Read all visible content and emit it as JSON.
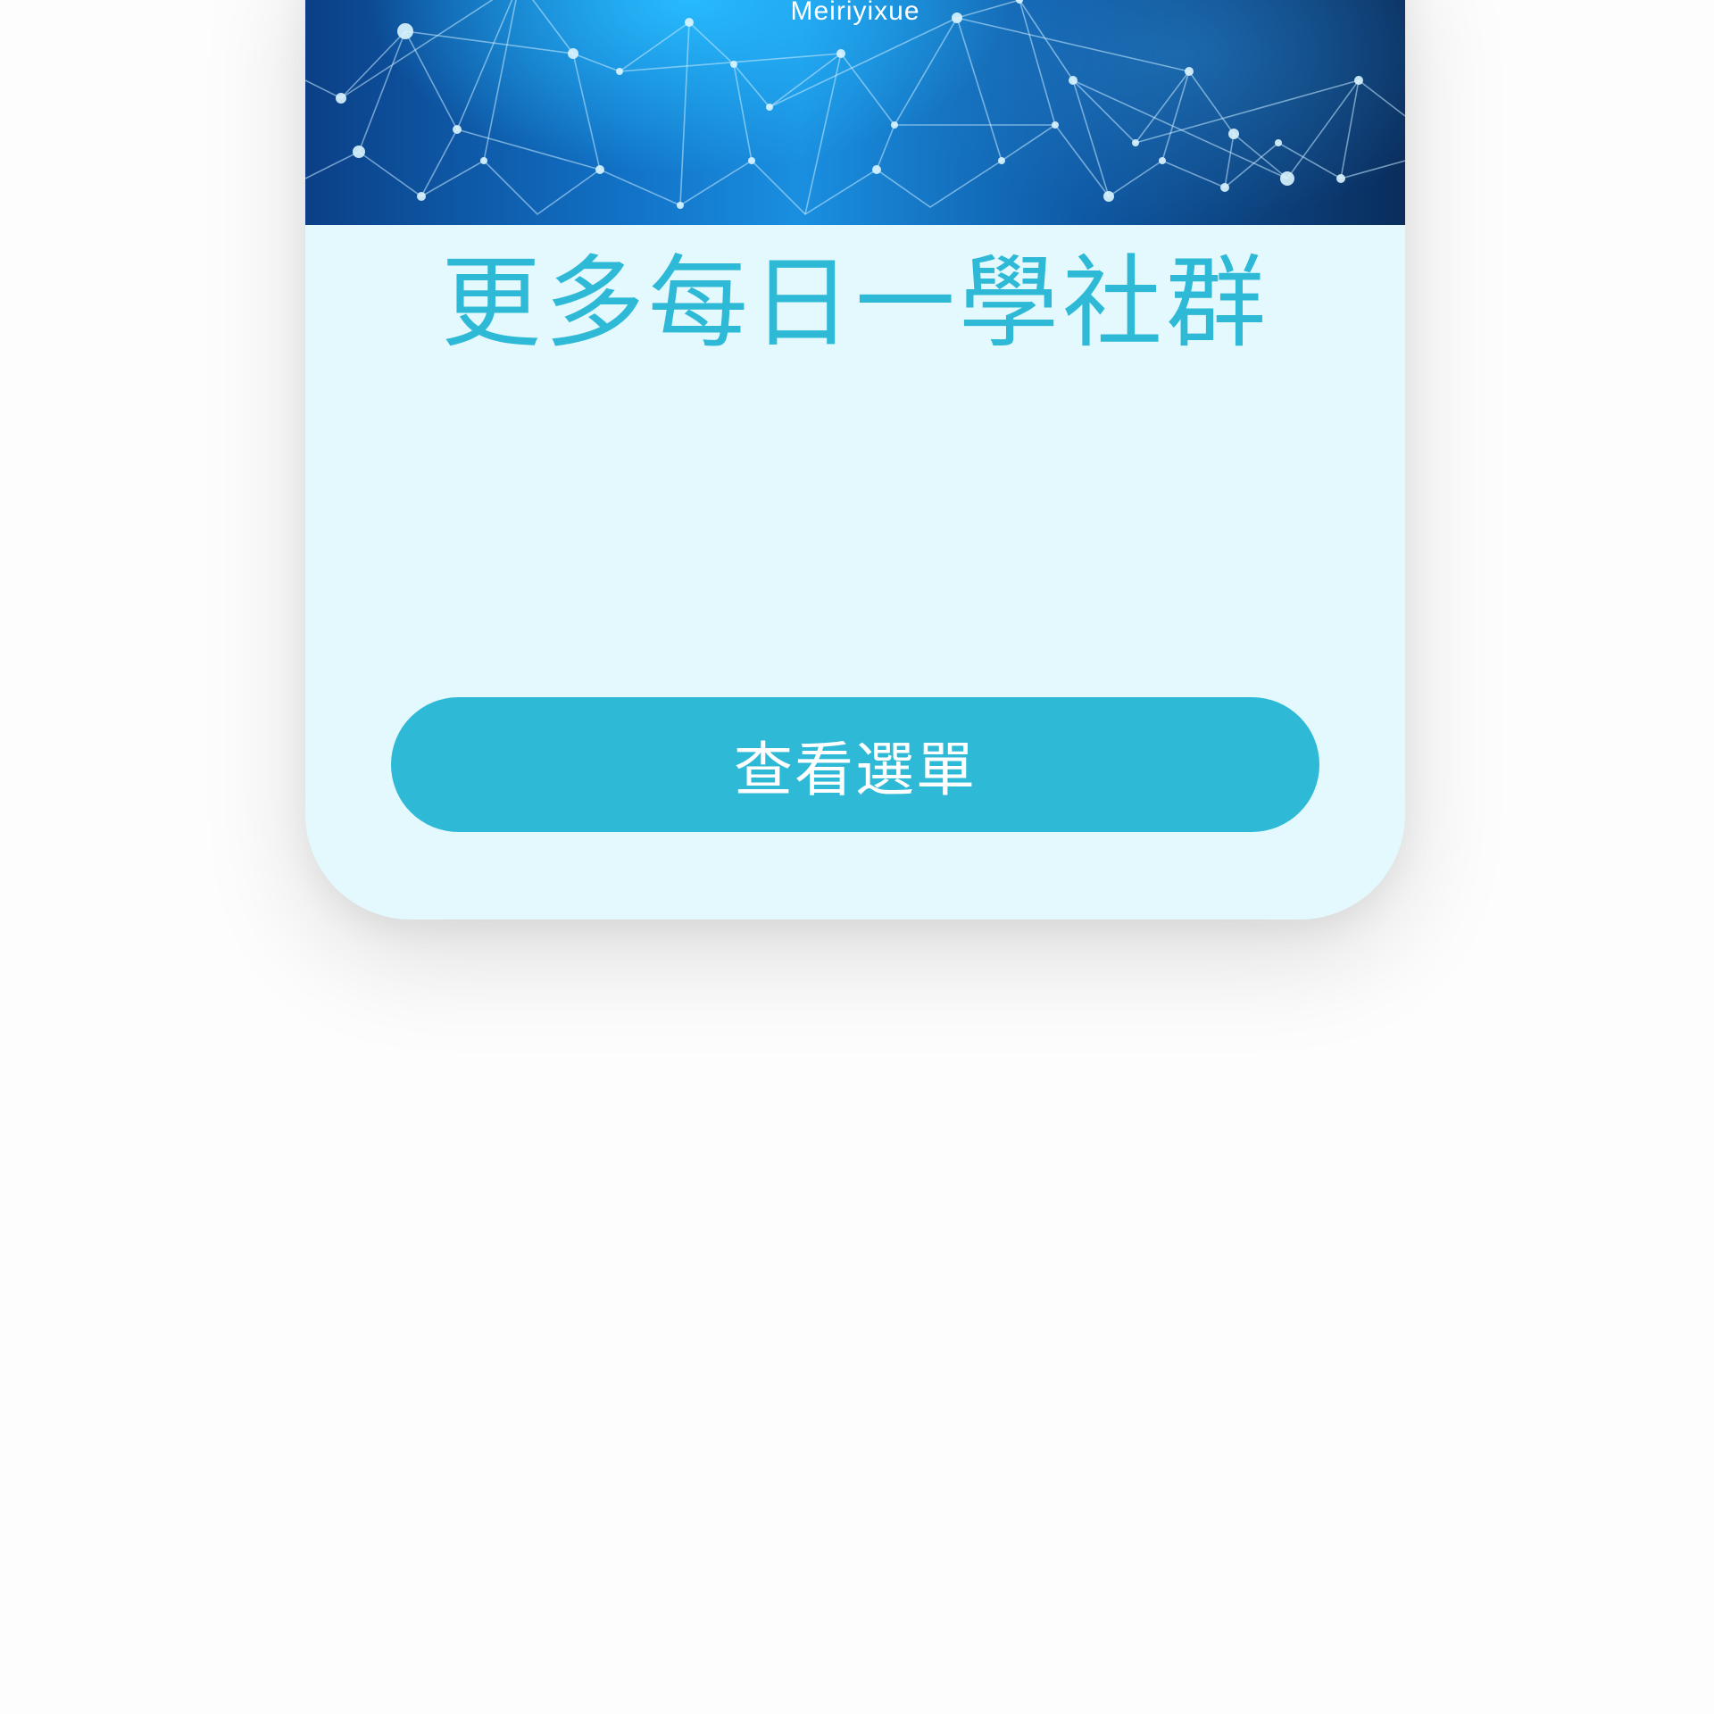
{
  "banner": {
    "brand_text": "Meiriyixue"
  },
  "main": {
    "heading": "更多每日一學社群",
    "menu_button_label": "查看選單"
  },
  "colors": {
    "accent": "#2eb9d7",
    "card_background": "#e3f9fd",
    "page_background": "#fdfdfd",
    "button_text": "#ffffff"
  }
}
